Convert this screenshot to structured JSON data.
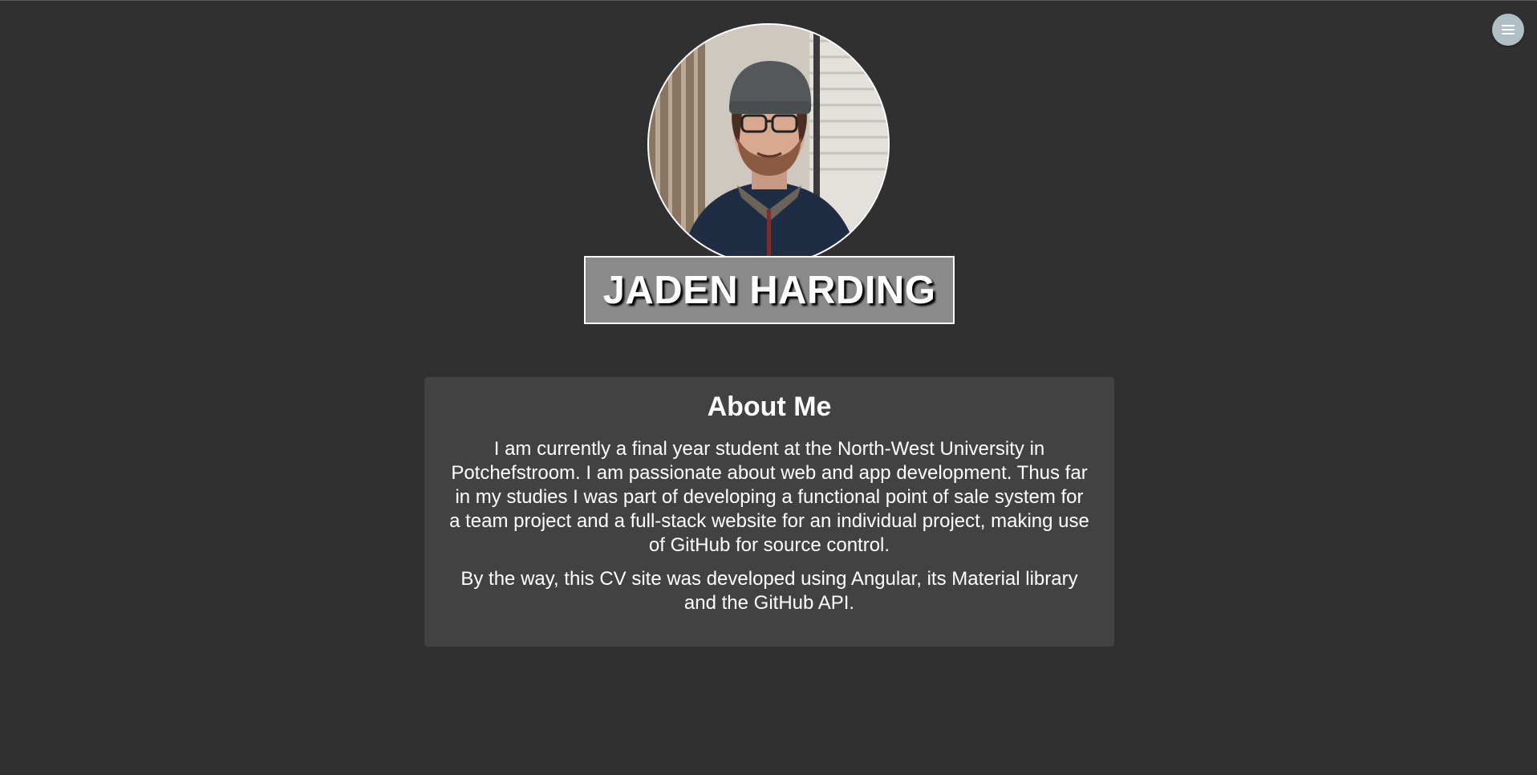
{
  "header": {
    "menu_icon": "menu-icon"
  },
  "profile": {
    "name": "JADEN HARDING",
    "avatar_icon": "profile-photo"
  },
  "about": {
    "title": "About Me",
    "paragraphs": [
      "I am currently a final year student at the North-West University in Potchefstroom. I am passionate about web and app development. Thus far in my studies I was part of developing a functional point of sale system for a team project and a full-stack website for an individual project, making use of GitHub for source control.",
      "By the way, this CV site was developed using Angular, its Material library and the GitHub API."
    ]
  },
  "colors": {
    "background": "#303030",
    "card": "#424242",
    "name_box": "#8a8a8a",
    "menu_button": "#b0bec5"
  }
}
